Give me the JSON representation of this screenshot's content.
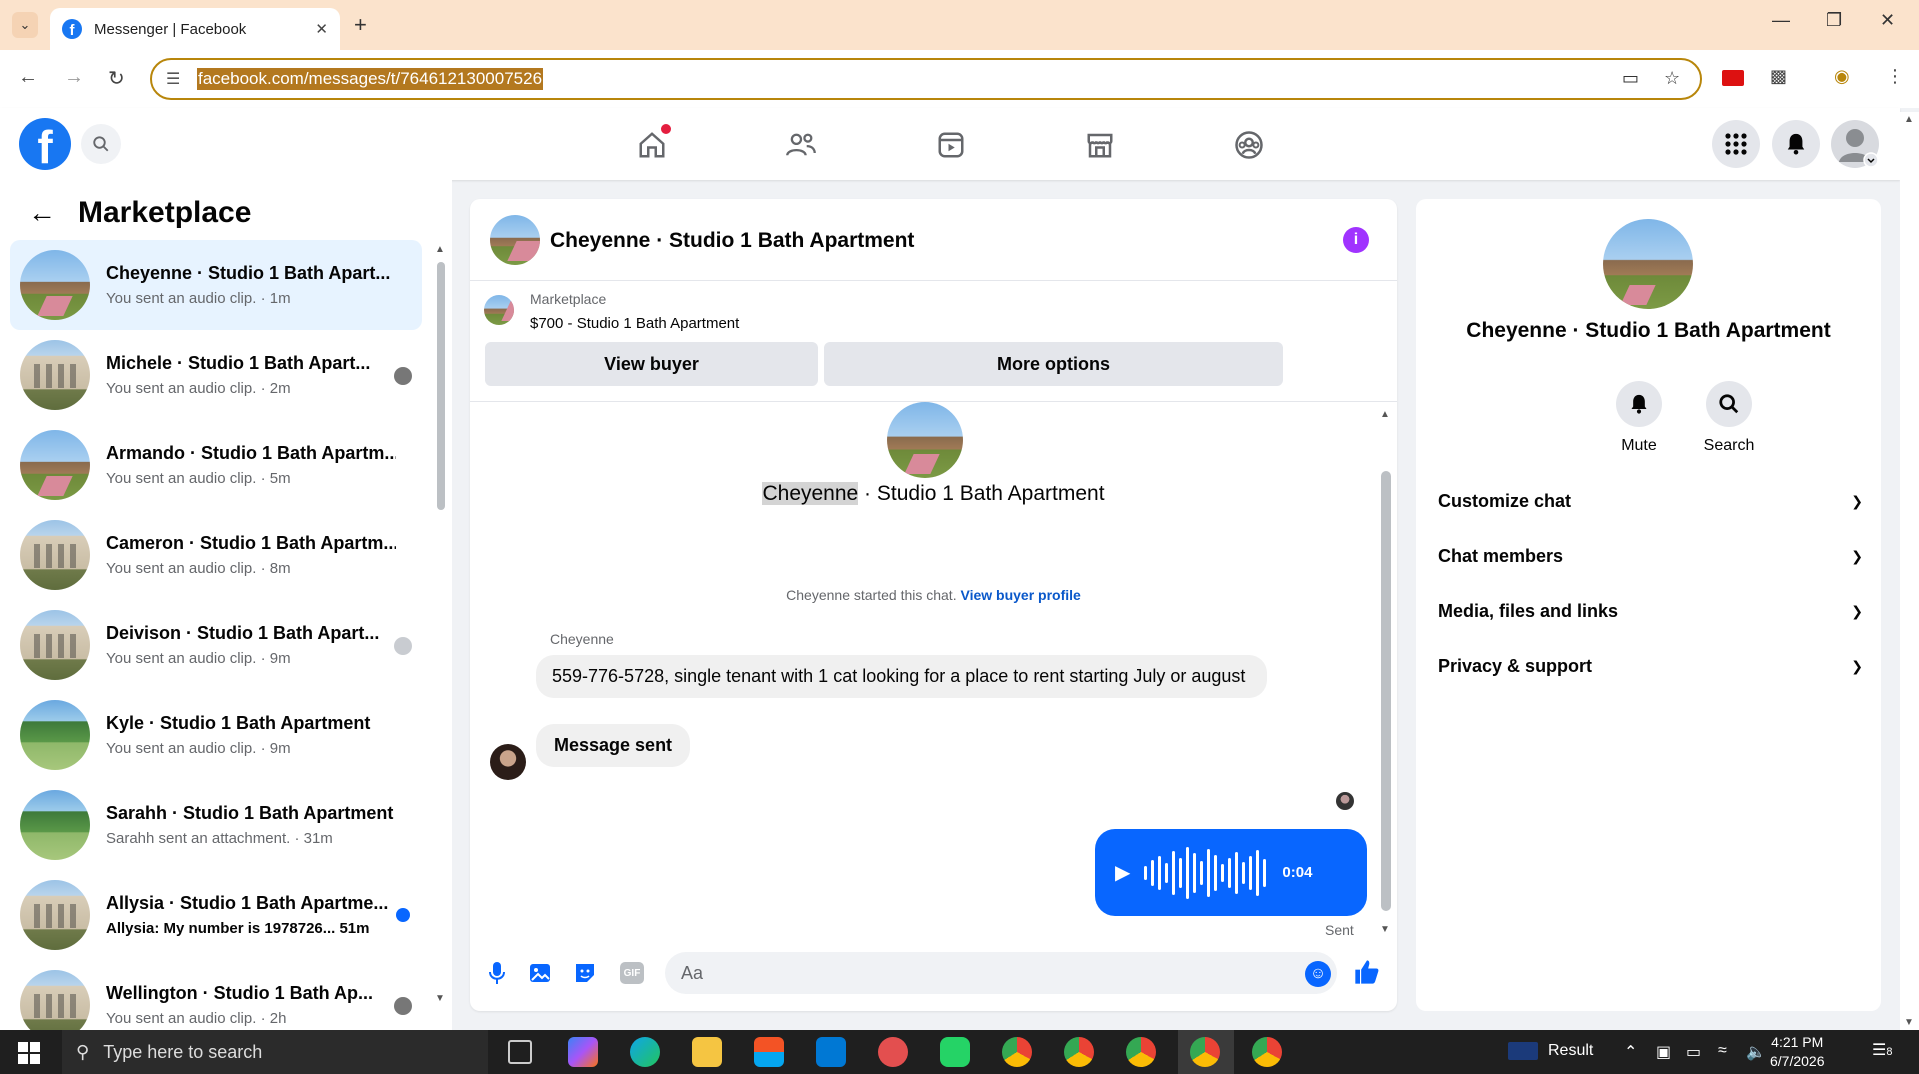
{
  "browser": {
    "tab_title": "Messenger | Facebook",
    "url": "facebook.com/messages/t/764612130007526"
  },
  "sidebar": {
    "title": "Marketplace",
    "conversations": [
      {
        "name": "Cheyenne · Studio 1 Bath Apart...",
        "subtitle": "You sent an audio clip. · 1m",
        "avatar": "house",
        "active": true,
        "badge": ""
      },
      {
        "name": "Michele · Studio 1 Bath Apart...",
        "subtitle": "You sent an audio clip. · 2m",
        "avatar": "apartment",
        "badge": "user"
      },
      {
        "name": "Armando · Studio 1 Bath Apartm...",
        "subtitle": "You sent an audio clip. · 5m",
        "avatar": "house",
        "badge": ""
      },
      {
        "name": "Cameron · Studio 1 Bath Apartm...",
        "subtitle": "You sent an audio clip. · 8m",
        "avatar": "apartment",
        "badge": ""
      },
      {
        "name": "Deivison · Studio 1 Bath Apart...",
        "subtitle": "You sent an audio clip. · 9m",
        "avatar": "apartment",
        "badge": "gray"
      },
      {
        "name": "Kyle · Studio 1 Bath Apartment",
        "subtitle": "You sent an audio clip. · 9m",
        "avatar": "tree",
        "badge": ""
      },
      {
        "name": "Sarahh · Studio 1 Bath Apartment",
        "subtitle": "Sarahh sent an attachment. · 31m",
        "avatar": "tree",
        "badge": ""
      },
      {
        "name": "Allysia · Studio 1 Bath Apartme...",
        "subtitle": "Allysia: My number is 1978726...  51m",
        "avatar": "apartment",
        "badge": "blue",
        "unread": true
      },
      {
        "name": "Wellington · Studio 1 Bath Ap...",
        "subtitle": "You sent an audio clip. · 2h",
        "avatar": "apartment",
        "badge": "user"
      }
    ]
  },
  "chat": {
    "title": "Cheyenne · Studio 1 Bath Apartment",
    "marketplace_label": "Marketplace",
    "listing": "$700 - Studio 1 Bath Apartment",
    "view_buyer": "View buyer",
    "more_options": "More options",
    "intro_first": "Cheyenne",
    "intro_rest": " · Studio 1 Bath Apartment",
    "started_text": "Cheyenne started this chat. ",
    "started_link": "View buyer profile",
    "sender_name": "Cheyenne",
    "message_1": "559-776-5728, single tenant with 1 cat looking for a place to rent starting July or august",
    "message_2": "Message sent",
    "audio_duration": "0:04",
    "sent_status": "Sent",
    "input_placeholder": "Aa"
  },
  "info_panel": {
    "name": "Cheyenne · Studio 1 Bath Apartment",
    "mute_label": "Mute",
    "search_label": "Search",
    "sections": [
      "Customize chat",
      "Chat members",
      "Media, files and links",
      "Privacy & support"
    ]
  },
  "taskbar": {
    "search_placeholder": "Type here to search",
    "weather": "Result",
    "time": "4:21 PM",
    "date": "6/7/2026",
    "notifications": "8"
  },
  "colors": {
    "accent": "#0866ff",
    "brand": "#1877f2",
    "info_purple": "#a033ff"
  }
}
